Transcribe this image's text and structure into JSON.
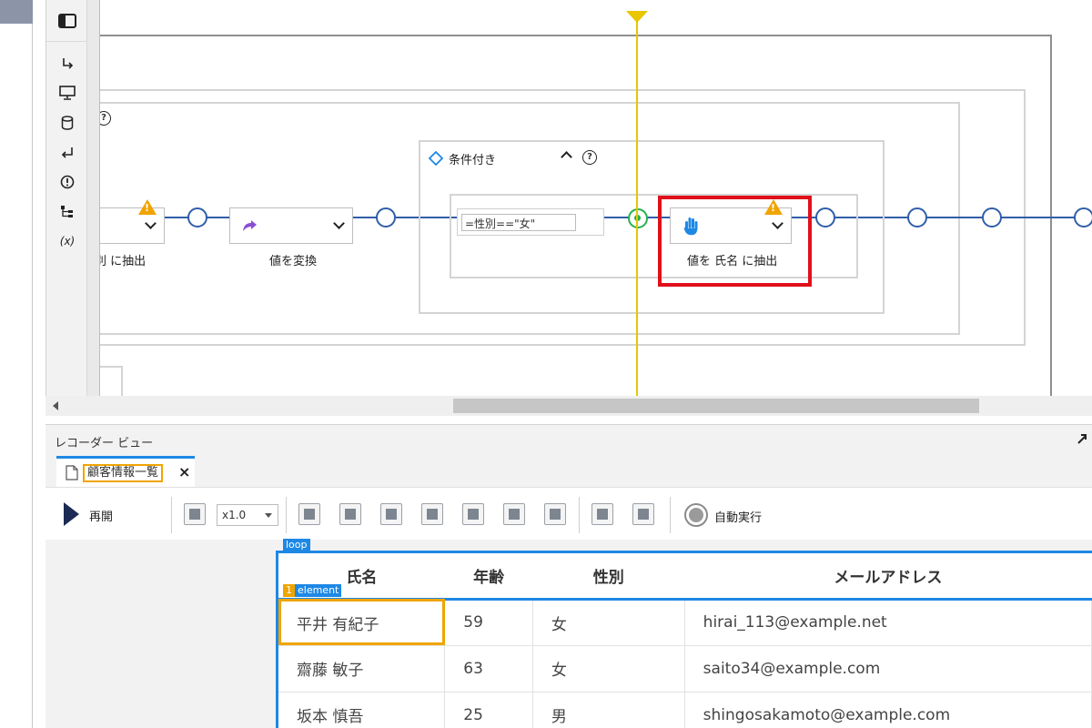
{
  "canvas": {
    "help_label": "?",
    "nodes": {
      "left_node_label": "別 に抽出",
      "transform_label": "値を変換",
      "extract_label": "値を 氏名 に抽出"
    },
    "condition": {
      "title": "条件付き",
      "expression": "=性別==\"女\""
    }
  },
  "recorder": {
    "title": "レコーダー ビュー",
    "tab_label": "顧客情報一覧",
    "toolbar": {
      "resume_label": "再開",
      "speed_value": "x1.0",
      "auto_run_label": "自動実行"
    },
    "tags": {
      "loop": "loop",
      "element_index": "1",
      "element": "element"
    },
    "table": {
      "headers": [
        "氏名",
        "年齢",
        "性別",
        "メールアドレス"
      ],
      "rows": [
        [
          "平井 有紀子",
          "59",
          "女",
          "hirai_113@example.net"
        ],
        [
          "齋藤 敏子",
          "63",
          "女",
          "saito34@example.com"
        ],
        [
          "坂本 慎吾",
          "25",
          "男",
          "shingosakamoto@example.com"
        ]
      ]
    }
  },
  "colors": {
    "accent_blue": "#1e88e5",
    "flow_blue": "#2f5ea8",
    "highlight_red": "#e0101a",
    "warning_orange": "#f0a400",
    "cursor_yellow": "#e8c600",
    "active_green": "#22b24c"
  }
}
